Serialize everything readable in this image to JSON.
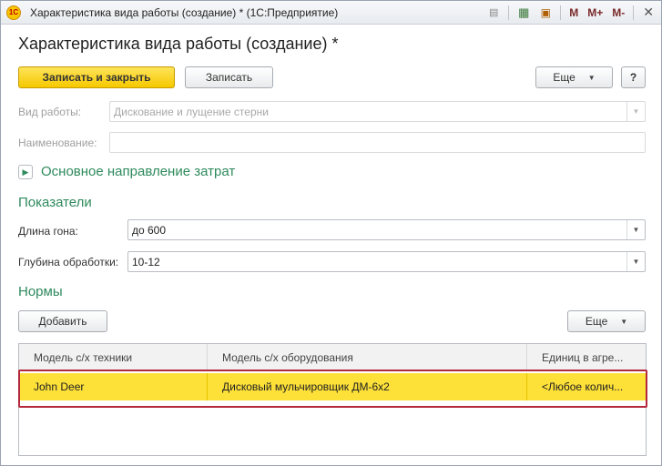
{
  "window": {
    "title": "Характеристика вида работы (создание) * (1С:Предприятие)",
    "logo_text": "1С",
    "toolbar_icons": [
      "docs-icon",
      "calculator-icon",
      "calendar-icon"
    ],
    "mem_buttons": [
      "M",
      "M+",
      "M-"
    ]
  },
  "form": {
    "title": "Характеристика вида работы (создание) *"
  },
  "command_bar": {
    "save_close_label": "Записать и закрыть",
    "save_label": "Записать",
    "more_label": "Еще",
    "help_label": "?"
  },
  "fields": {
    "work_type": {
      "label": "Вид работы:",
      "value": "Дискование и лущение стерни"
    },
    "name": {
      "label": "Наименование:",
      "value": ""
    }
  },
  "cost_section": {
    "title": "Основное направление затрат",
    "collapsed": true
  },
  "indicators": {
    "title": "Показатели",
    "length": {
      "label": "Длина гона:",
      "value": "до 600"
    },
    "depth": {
      "label": "Глубина обработки:",
      "value": "10-12"
    }
  },
  "norms": {
    "title": "Нормы",
    "add_label": "Добавить",
    "more_label": "Еще",
    "columns": [
      "Модель с/х техники",
      "Модель с/х оборудования",
      "Единиц в агре..."
    ],
    "rows": [
      [
        "John Deer",
        "Дисковый мульчировщик ДМ-6х2",
        "<Любое колич..."
      ]
    ]
  },
  "colors": {
    "accent_green": "#2e8a5c",
    "primary_button": "#f5c800",
    "selected_row": "#fde038",
    "highlight_border": "#b3283b"
  }
}
